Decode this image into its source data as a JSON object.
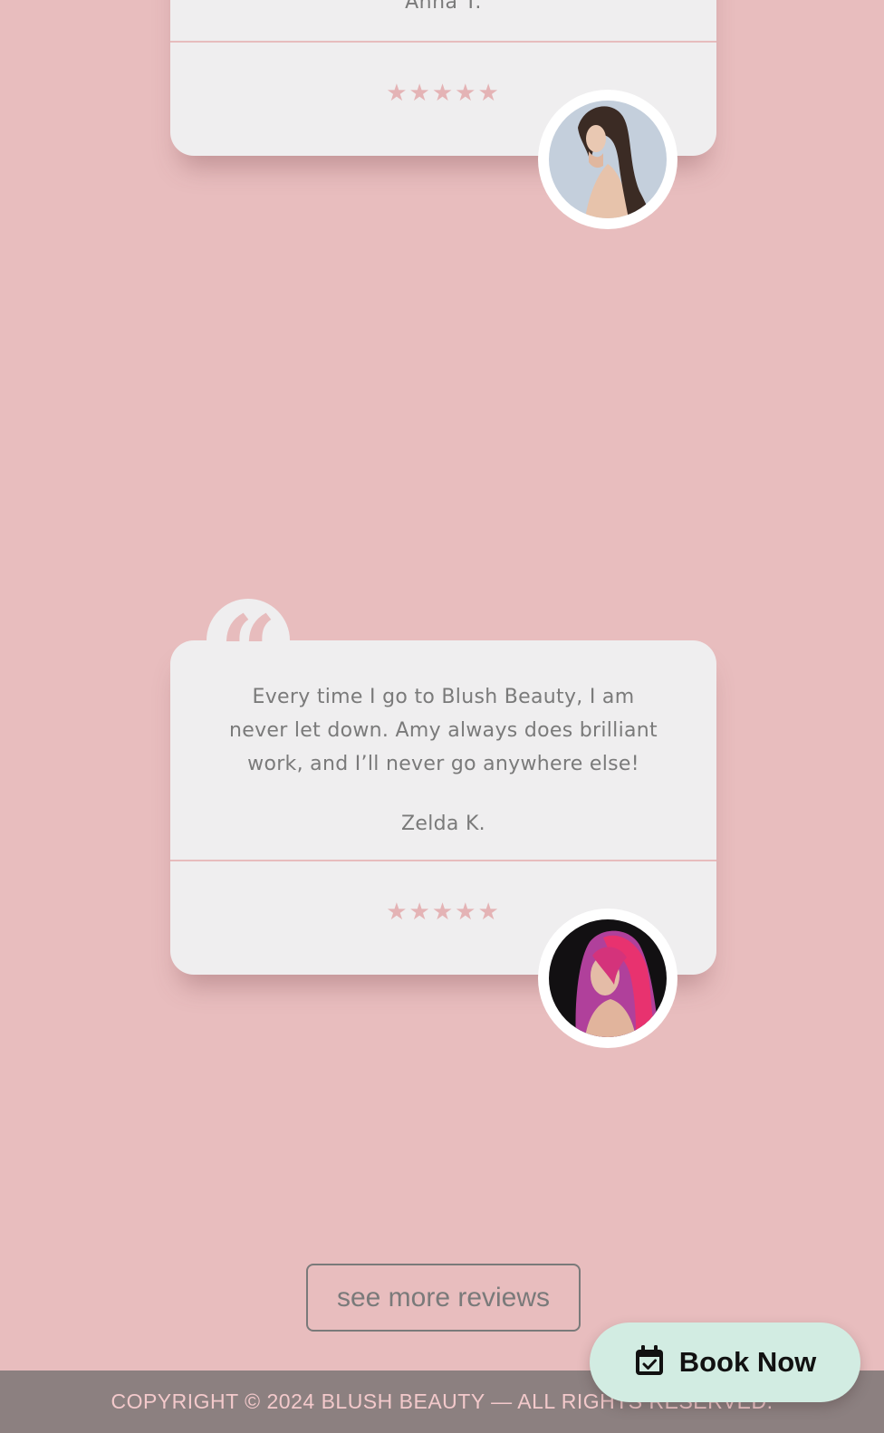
{
  "reviews": [
    {
      "author": "Anna T.",
      "stars": "★★★★★",
      "avatar": "woman-long-brown-hair-avatar"
    },
    {
      "text": "Every time I go to Blush Beauty, I am never let down. Amy always does brilliant work, and I’ll never go anywhere else!",
      "author": "Zelda K.",
      "stars": "★★★★★",
      "avatar": "woman-pink-purple-hair-avatar"
    }
  ],
  "quote_mark": "“",
  "more_button": "see more reviews",
  "book_button": {
    "label": "Book Now",
    "icon": "calendar-check-icon"
  },
  "footer": {
    "copyright": "COPYRIGHT © 2024 BLUSH BEAUTY — ALL RIGHTS RESERVED."
  },
  "colors": {
    "background": "#e8bdbe",
    "card": "#efeeef",
    "text": "#7a7a7a",
    "star": "#e4b3b5",
    "book_button": "#d2ece2",
    "footer": "#8c8080"
  }
}
